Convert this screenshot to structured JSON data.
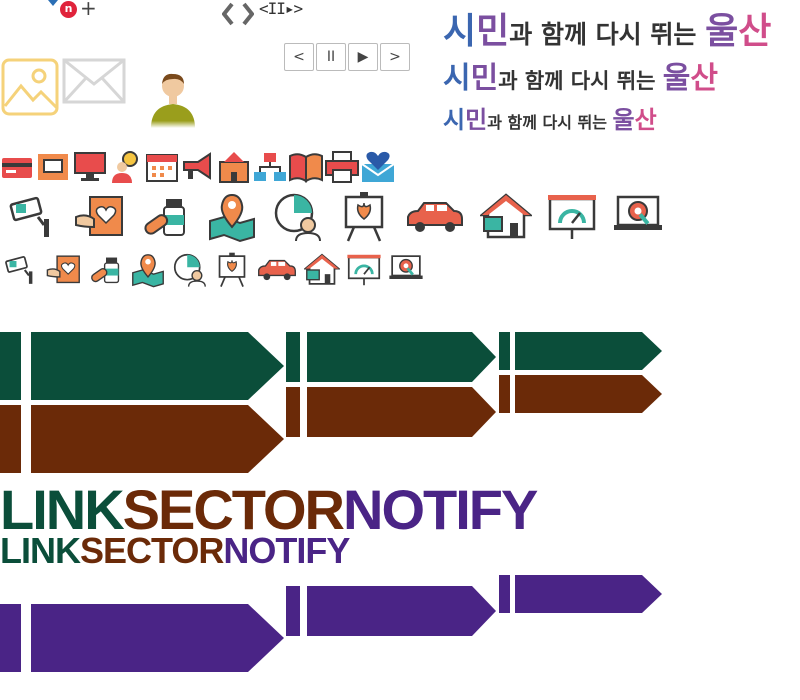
{
  "top_controls": {
    "badge": "n",
    "plus": "+",
    "mini_ctrl": "<II▸>"
  },
  "pager": {
    "buttons": [
      "<",
      "II",
      "▶",
      ">"
    ]
  },
  "slogan": {
    "si": "시",
    "min": "민",
    "middle": "과 함께 다시 뛰는 ",
    "ul": "울",
    "san": "산"
  },
  "brand_words": {
    "link": "LINK",
    "sector": "SECTOR",
    "notify": "NOTIFY"
  },
  "colors": {
    "link": "#0b4e3a",
    "sector": "#6b2a08",
    "notify": "#4a2486",
    "accent_blue": "#3b66b0",
    "accent_pink": "#d04d8a"
  },
  "icons": {
    "row1": [
      "card-icon",
      "message-box-icon",
      "monitor-icon",
      "person-idea-icon",
      "calendar-icon",
      "megaphone-icon",
      "building-icon",
      "network-icon",
      "book-icon",
      "printer-icon",
      "heart-mail-icon"
    ],
    "row2": [
      "cctv-icon",
      "hand-heart-card-icon",
      "pill-bottle-icon",
      "map-pin-icon",
      "clock-person-icon",
      "easel-flower-icon",
      "car-icon",
      "house-icon",
      "gauge-board-icon",
      "laptop-gear-icon"
    ]
  }
}
